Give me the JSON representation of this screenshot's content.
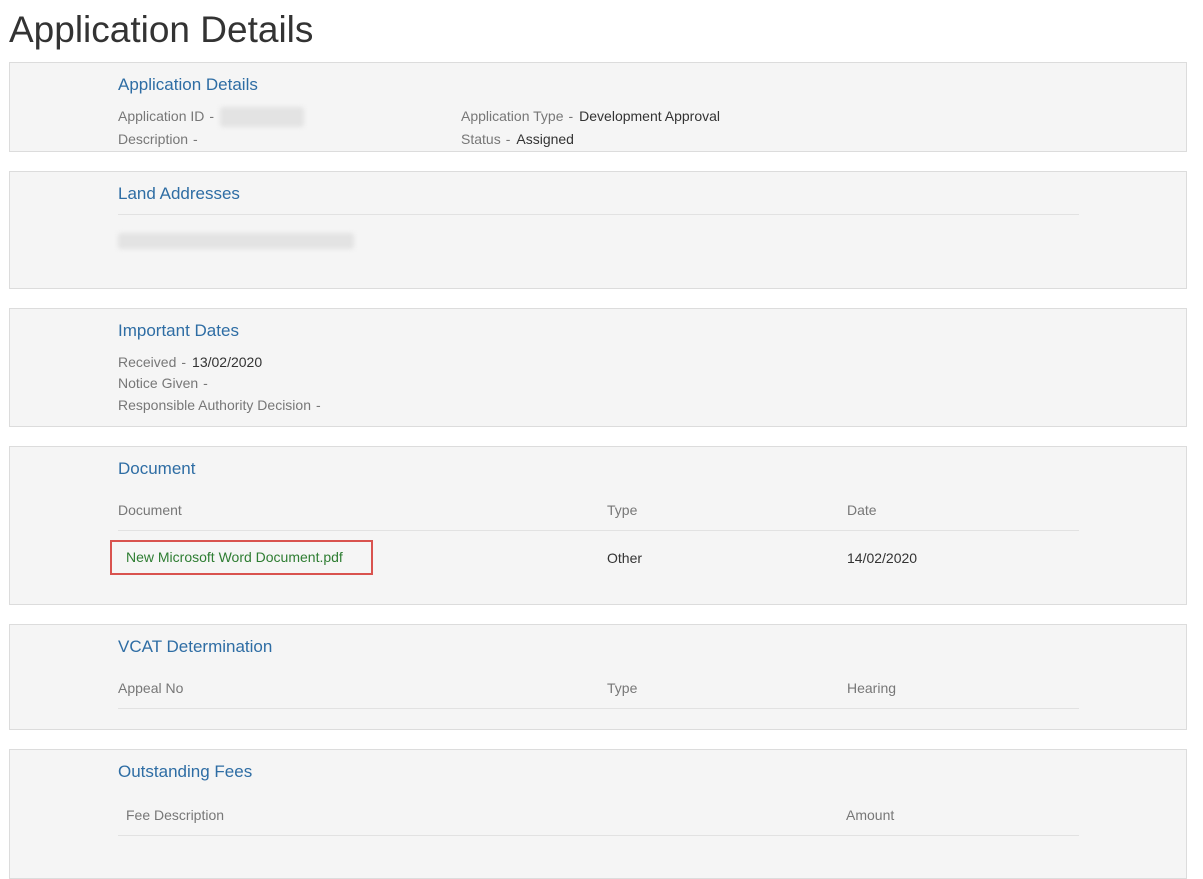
{
  "page": {
    "title": "Application Details"
  },
  "application_details": {
    "title": "Application Details",
    "id_label": "Application ID",
    "description_label": "Description",
    "description_value": "",
    "type_label": "Application Type",
    "type_value": "Development Approval",
    "status_label": "Status",
    "status_value": "Assigned",
    "separator": "-"
  },
  "land_addresses": {
    "title": "Land Addresses"
  },
  "important_dates": {
    "title": "Important Dates",
    "received_label": "Received",
    "received_value": "13/02/2020",
    "notice_label": "Notice Given",
    "notice_value": "",
    "decision_label": "Responsible Authority Decision",
    "decision_value": "",
    "separator": "-"
  },
  "document": {
    "title": "Document",
    "columns": [
      "Document",
      "Type",
      "Date"
    ],
    "rows": [
      {
        "name": "New Microsoft Word Document.pdf",
        "type": "Other",
        "date": "14/02/2020"
      }
    ]
  },
  "vcat": {
    "title": "VCAT Determination",
    "columns": [
      "Appeal No",
      "Type",
      "Hearing"
    ]
  },
  "fees": {
    "title": "Outstanding Fees",
    "columns": [
      "Fee Description",
      "Amount"
    ]
  },
  "colors": {
    "heading_blue": "#2e6da4",
    "link_green": "#2e7d32",
    "highlight_red": "#d9534f",
    "card_bg": "#f5f5f5"
  }
}
